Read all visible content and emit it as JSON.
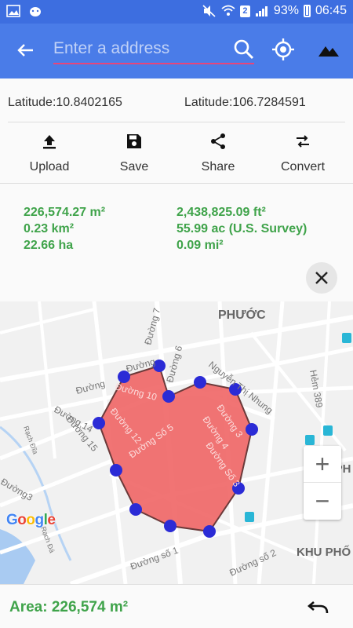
{
  "status_bar": {
    "battery": "93%",
    "time": "06:45",
    "sim": "2"
  },
  "app_bar": {
    "search_placeholder": "Enter a address"
  },
  "coordinates": {
    "latitude_text": "Latitude:10.8402165",
    "longitude_text": "Latitude:106.7284591"
  },
  "toolbar": {
    "upload": "Upload",
    "save": "Save",
    "share": "Share",
    "convert": "Convert"
  },
  "measurements": {
    "sq_m": "226,574.27 m²",
    "sq_km": "0.23 km²",
    "ha": "22.66 ha",
    "sq_ft": "2,438,825.09 ft²",
    "acres": "55.99 ac (U.S. Survey)",
    "sq_mi": "0.09 mi²"
  },
  "map": {
    "labels": {
      "phuoc": "PHƯỚC",
      "khu_pho_1": "KHU PH",
      "khu_pho_2": "KHU PHỐ",
      "nguyen_thi_nhung": "Nguyễn Thị Nhung",
      "hem_389": "Hẻm 389",
      "duong_7": "Đường 7",
      "duong_6": "Đường 6",
      "duong_10": "Đường 10",
      "duong_12": "Đường 12",
      "duong_14": "Đường 14",
      "duong_15": "Đường 15",
      "duong_so_5": "Đường Số 5",
      "duong_3": "Đường 3",
      "duong_4": "Đường 4",
      "duong_so_3": "Đường Số 3",
      "duong_so_1": "Đường số 1",
      "duong_so_2": "Đường số 2",
      "duong": "Đường",
      "duong_left": "Đường",
      "duong3_left": "Đường3",
      "rach_da_1": "Rạch Đĩa",
      "rach_da_2": "Rạch Đá"
    },
    "google_letters": [
      "G",
      "o",
      "o",
      "g",
      "l",
      "e"
    ],
    "google_colors": [
      "#4285F4",
      "#EA4335",
      "#FBBC05",
      "#4285F4",
      "#34A853",
      "#EA4335"
    ],
    "polygon_fill": "#f06868",
    "vertex_color": "#2b2bd6"
  },
  "zoom": {
    "plus": "+",
    "minus": "−"
  },
  "bottom": {
    "area_text": "Area: 226,574 m²"
  },
  "colors": {
    "app_bar": "#4a7ce8",
    "status_bar": "#3d6ee0",
    "accent_green": "#3fa34a",
    "input_underline": "#e8457a"
  }
}
